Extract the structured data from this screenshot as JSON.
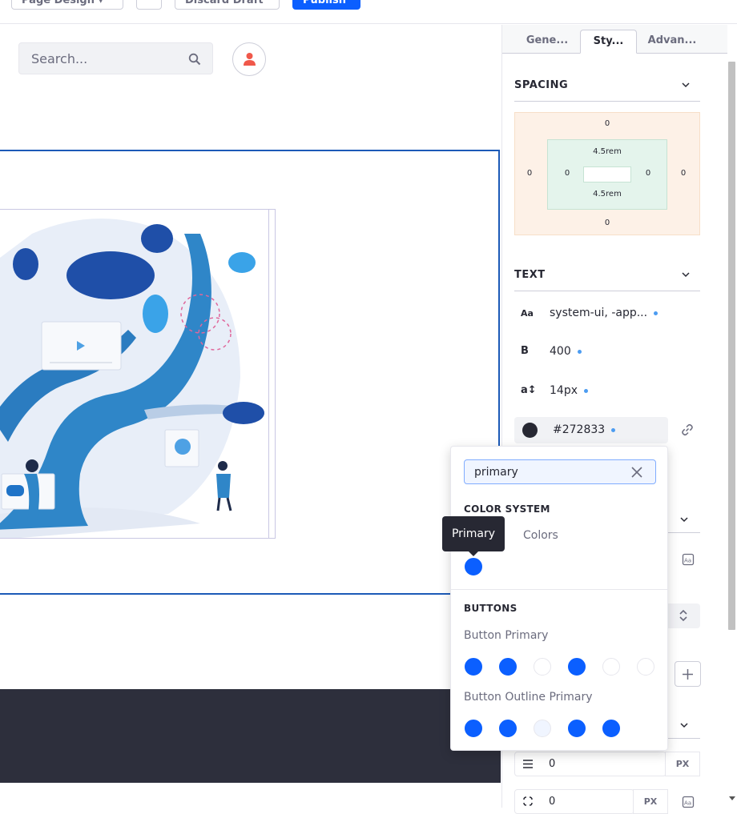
{
  "toolbar": {
    "mode_label": "Page Design",
    "discard_label": "Discard Draft",
    "publish_label": "Publish"
  },
  "canvas": {
    "search_placeholder": "Search..."
  },
  "sidebar": {
    "tabs": [
      "Gene...",
      "Sty...",
      "Advan..."
    ],
    "active_tab": 1,
    "spacing": {
      "title": "SPACING",
      "margin_top": "0",
      "margin_bottom": "0",
      "margin_left": "0",
      "margin_right": "0",
      "padding_top": "4.5rem",
      "padding_bottom": "4.5rem",
      "padding_left": "0",
      "padding_right": "0"
    },
    "text": {
      "title": "TEXT",
      "font_icon": "Aa",
      "font_family": "system-ui, -app...",
      "weight_icon": "B",
      "font_weight": "400",
      "size_icon": "a↕",
      "font_size": "14px",
      "color_value": "#272833",
      "color_swatch": "#272833"
    },
    "fields": [
      {
        "value": "0",
        "unit": "PX"
      },
      {
        "value": "0",
        "unit": "PX"
      }
    ]
  },
  "color_picker": {
    "search_value": "primary",
    "color_system_heading": "COLOR SYSTEM",
    "color_system_sub": "Colors",
    "tooltip": "Primary",
    "color_system_swatches": [
      "#0b5fff"
    ],
    "buttons_heading": "BUTTONS",
    "button_primary_label": "Button Primary",
    "button_primary_swatches": [
      "#0b5fff",
      "#0b5fff",
      "#ffffff",
      "#0b5fff",
      "#ffffff",
      "#ffffff"
    ],
    "button_outline_label": "Button Outline Primary",
    "button_outline_swatches": [
      "#0b5fff",
      "#0b5fff",
      "#f0f5ff",
      "#0b5fff",
      "#0b5fff"
    ]
  },
  "colors": {
    "accent": "#0b5fff",
    "footer": "#2d2f3c",
    "fragment_border": "#1c5ab7"
  }
}
